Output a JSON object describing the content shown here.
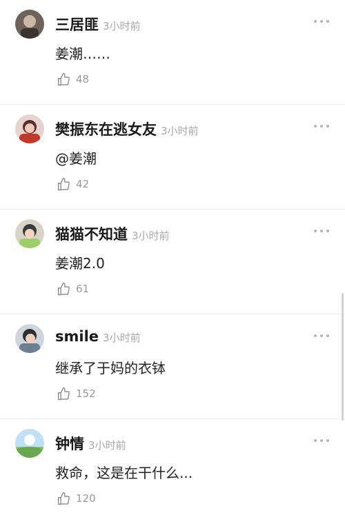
{
  "comments": [
    {
      "user": "三居匪",
      "time": "3小时前",
      "text": "姜潮……",
      "likes": "48"
    },
    {
      "user": "樊振东在逃女友",
      "time": "3小时前",
      "text": "@姜潮",
      "likes": "42"
    },
    {
      "user": "猫猫不知道",
      "time": "3小时前",
      "text": "姜潮2.0",
      "likes": "61"
    },
    {
      "user": "smile",
      "time": "3小时前",
      "text": "继承了于妈的衣钵",
      "likes": "152"
    },
    {
      "user": "钟情",
      "time": "3小时前",
      "text": "救命，这是在干什么...",
      "likes": "120"
    }
  ],
  "icons": {
    "like": "thumbs-up-icon",
    "more": "more-dots-icon"
  }
}
